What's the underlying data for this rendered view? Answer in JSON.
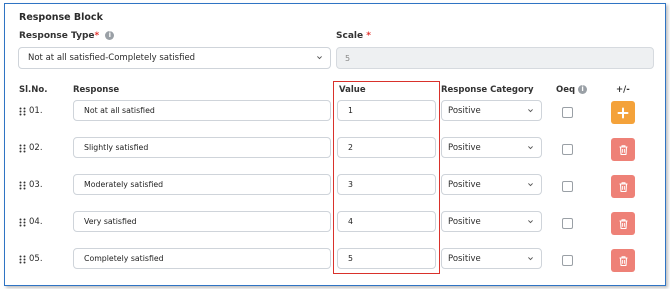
{
  "block_title": "Response Block",
  "response_type": {
    "label": "Response Type",
    "required_mark": "*",
    "value": "Not at all satisfied-Completely satisfied"
  },
  "scale": {
    "label": "Scale",
    "required_mark": "*",
    "value": "5"
  },
  "columns": {
    "sl_no": "Sl.No.",
    "response": "Response",
    "value": "Value",
    "category": "Response Category",
    "oeq": "Oeq",
    "add_remove": "+/-"
  },
  "rows": [
    {
      "sl": "01.",
      "response": "Not at all satisfied",
      "value": "1",
      "category": "Positive"
    },
    {
      "sl": "02.",
      "response": "Slightly satisfied",
      "value": "2",
      "category": "Positive"
    },
    {
      "sl": "03.",
      "response": "Moderately satisfied",
      "value": "3",
      "category": "Positive"
    },
    {
      "sl": "04.",
      "response": "Very satisfied",
      "value": "4",
      "category": "Positive"
    },
    {
      "sl": "05.",
      "response": "Completely satisfied",
      "value": "5",
      "category": "Positive"
    }
  ],
  "colors": {
    "add_button": "#f4a23a",
    "delete_button": "#ee8177",
    "highlight_border": "#d9312b",
    "frame_border": "#2f74c4"
  },
  "icons": {
    "info": "info-icon",
    "chevron": "chevron-down-icon",
    "grip": "drag-handle-icon",
    "add": "plus-icon",
    "delete": "trash-icon"
  }
}
